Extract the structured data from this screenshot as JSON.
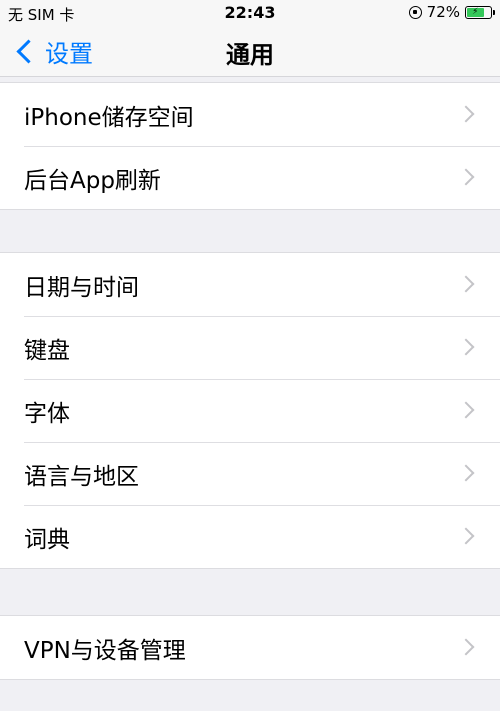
{
  "status_bar": {
    "carrier": "无 SIM 卡",
    "time": "22:43",
    "battery_percent": "72%",
    "battery_level": 0.72,
    "battery_color": "#34c759"
  },
  "nav": {
    "back_label": "设置",
    "title": "通用",
    "accent_color": "#007aff"
  },
  "groups": [
    {
      "items": [
        {
          "label": "iPhone储存空间"
        },
        {
          "label": "后台App刷新"
        }
      ]
    },
    {
      "items": [
        {
          "label": "日期与时间"
        },
        {
          "label": "键盘"
        },
        {
          "label": "字体"
        },
        {
          "label": "语言与地区"
        },
        {
          "label": "词典"
        }
      ]
    },
    {
      "items": [
        {
          "label": "VPN与设备管理"
        }
      ]
    }
  ]
}
